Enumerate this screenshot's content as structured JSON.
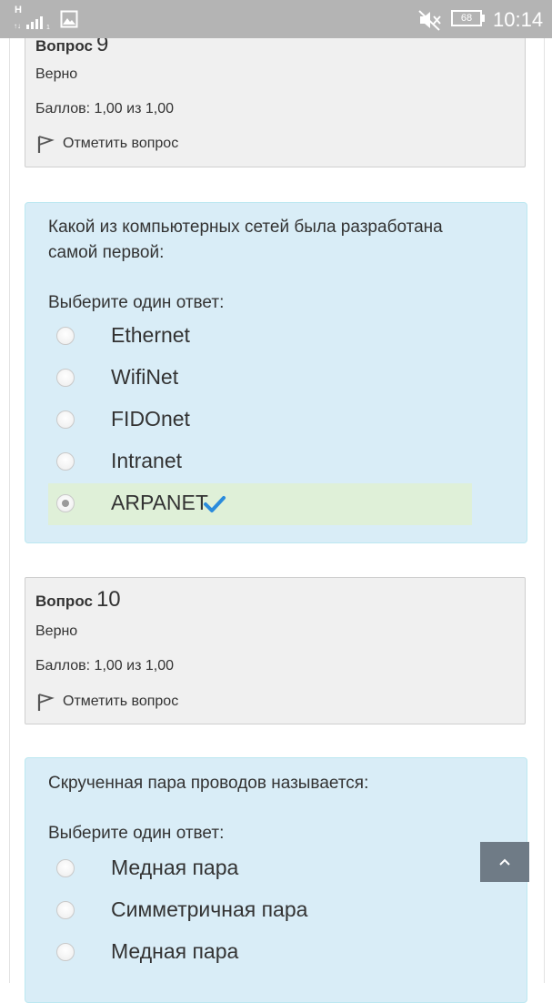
{
  "status_bar": {
    "network_type": "H",
    "battery": "68",
    "time": "10:14"
  },
  "question9": {
    "label": "Вопрос",
    "number": "9",
    "state": "Верно",
    "grade": "Баллов: 1,00 из 1,00",
    "flag_label": "Отметить вопрос",
    "text": "Какой из компьютерных сетей была разработана самой первой:",
    "prompt": "Выберите один ответ:",
    "options": [
      "Ethernet",
      "WifiNet",
      "FIDOnet",
      "Intranet",
      "ARPANET"
    ],
    "selected": "ARPANET"
  },
  "question10": {
    "label": "Вопрос",
    "number": "10",
    "state": "Верно",
    "grade": "Баллов: 1,00 из 1,00",
    "flag_label": "Отметить вопрос",
    "text": "Скрученная пара проводов называется:",
    "prompt": "Выберите один ответ:",
    "options": [
      "Медная пара",
      "Симметричная пара",
      "Медная пара"
    ]
  },
  "colors": {
    "formulation_bg": "#d9edf7",
    "correct_bg": "#dff0d8",
    "info_bg": "#f0f0f0",
    "checkmark": "#2a8bdc",
    "scroll_button": "#6f7b86"
  }
}
